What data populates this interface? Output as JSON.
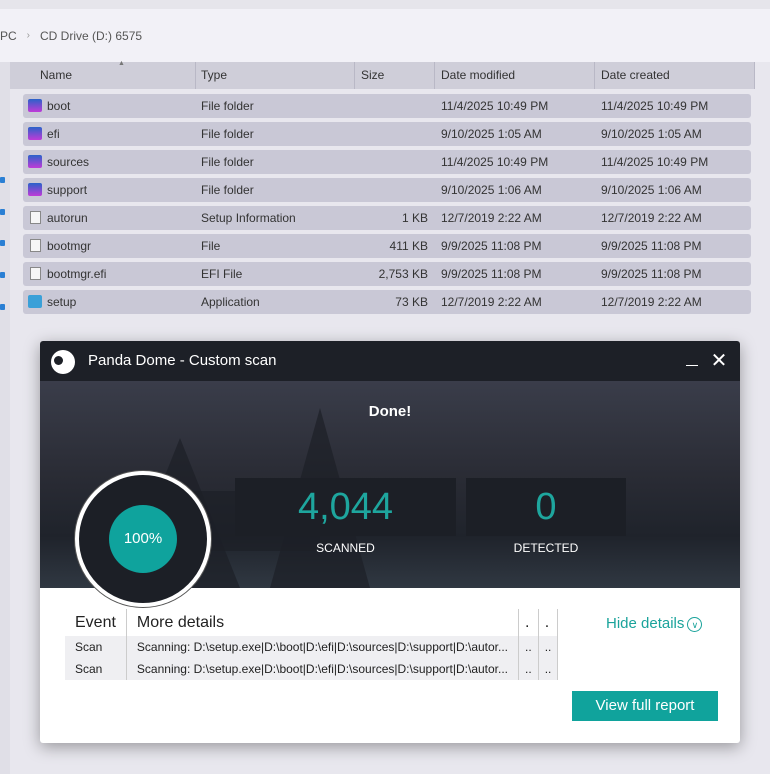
{
  "breadcrumb": {
    "parent": "PC",
    "current": "CD Drive (D:) 6575"
  },
  "columns": [
    "Name",
    "Type",
    "Size",
    "Date modified",
    "Date created"
  ],
  "files": [
    {
      "name": "boot",
      "type": "File folder",
      "size": "",
      "modified": "11/4/2025 10:49 PM",
      "created": "11/4/2025 10:49 PM",
      "icon": "folder"
    },
    {
      "name": "efi",
      "type": "File folder",
      "size": "",
      "modified": "9/10/2025 1:05 AM",
      "created": "9/10/2025 1:05 AM",
      "icon": "folder"
    },
    {
      "name": "sources",
      "type": "File folder",
      "size": "",
      "modified": "11/4/2025 10:49 PM",
      "created": "11/4/2025 10:49 PM",
      "icon": "folder"
    },
    {
      "name": "support",
      "type": "File folder",
      "size": "",
      "modified": "9/10/2025 1:06 AM",
      "created": "9/10/2025 1:06 AM",
      "icon": "folder"
    },
    {
      "name": "autorun",
      "type": "Setup Information",
      "size": "1 KB",
      "modified": "12/7/2019 2:22 AM",
      "created": "12/7/2019 2:22 AM",
      "icon": "file"
    },
    {
      "name": "bootmgr",
      "type": "File",
      "size": "411 KB",
      "modified": "9/9/2025 11:08 PM",
      "created": "9/9/2025 11:08 PM",
      "icon": "file"
    },
    {
      "name": "bootmgr.efi",
      "type": "EFI File",
      "size": "2,753 KB",
      "modified": "9/9/2025 11:08 PM",
      "created": "9/9/2025 11:08 PM",
      "icon": "file"
    },
    {
      "name": "setup",
      "type": "Application",
      "size": "73 KB",
      "modified": "12/7/2019 2:22 AM",
      "created": "12/7/2019 2:22 AM",
      "icon": "app"
    }
  ],
  "dialog": {
    "title": "Panda Dome - Custom scan",
    "status": "Done!",
    "progress_label": "100%",
    "progress": 100,
    "scanned_value": "4,044",
    "scanned_label": "SCANNED",
    "detected_value": "0",
    "detected_label": "DETECTED",
    "table_headers": [
      "Event",
      "More details",
      ".",
      "."
    ],
    "rows": [
      {
        "event": "Scan",
        "details": "Scanning: D:\\setup.exe|D:\\boot|D:\\efi|D:\\sources|D:\\support|D:\\autor...",
        "c3": "..",
        "c4": ".."
      },
      {
        "event": "Scan",
        "details": "Scanning: D:\\setup.exe|D:\\boot|D:\\efi|D:\\sources|D:\\support|D:\\autor...",
        "c3": "..",
        "c4": ".."
      }
    ],
    "hide_details": "Hide details",
    "view_report": "View full report",
    "accent": "#10a39c"
  }
}
